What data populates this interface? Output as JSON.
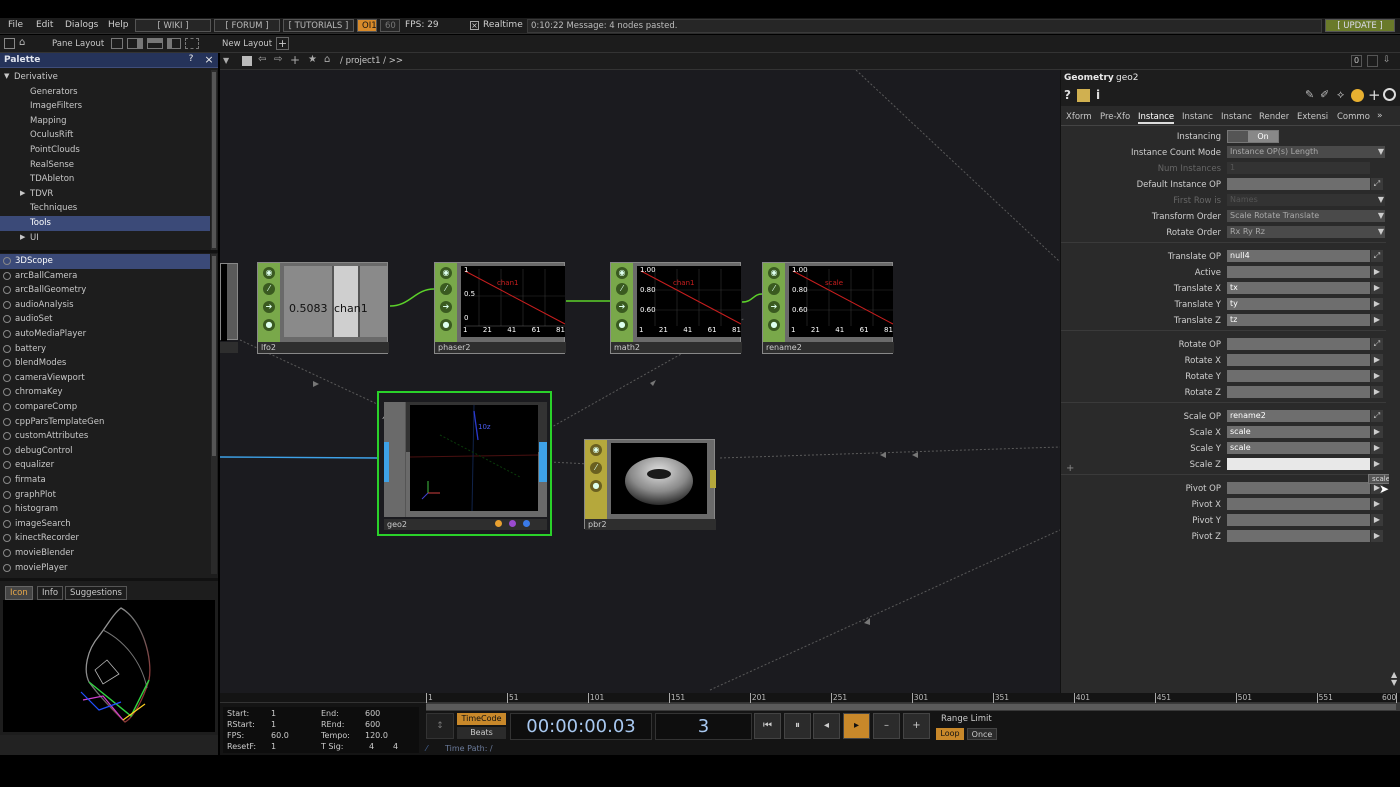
{
  "menu": {
    "items": [
      "File",
      "Edit",
      "Dialogs",
      "Help"
    ],
    "wiki": "[ WIKI ]",
    "forum": "[ FORUM ]",
    "tutorials": "[ TUTORIALS ]",
    "oi": "OI1",
    "sixty": "60",
    "fps": "FPS:  29",
    "realtime": "Realtime",
    "message": "0:10:22 Message: 4 nodes pasted.",
    "update": "[ UPDATE ]"
  },
  "toolbar": {
    "pane_layout": "Pane Layout",
    "new_layout": "New Layout",
    "path": "/ project1 / >>",
    "zero": "0"
  },
  "palette": {
    "title": "Palette",
    "help": "?",
    "close": "×",
    "tree": [
      "Derivative",
      "Generators",
      "ImageFilters",
      "Mapping",
      "OculusRift",
      "PointClouds",
      "RealSense",
      "TDAbleton",
      "TDVR",
      "Techniques",
      "Tools",
      "UI"
    ],
    "list": [
      "3DScope",
      "arcBallCamera",
      "arcBallGeometry",
      "audioAnalysis",
      "audioSet",
      "autoMediaPlayer",
      "battery",
      "blendModes",
      "cameraViewport",
      "chromaKey",
      "compareComp",
      "cppParsTemplateGen",
      "customAttributes",
      "debugControl",
      "equalizer",
      "firmata",
      "graphPlot",
      "histogram",
      "imageSearch",
      "kinectRecorder",
      "movieBlender",
      "moviePlayer"
    ],
    "tabs": [
      "Icon",
      "Info",
      "Suggestions"
    ]
  },
  "nodes": {
    "lfo": {
      "name": "lfo2",
      "value": "0.5083",
      "channel": "chan1"
    },
    "phaser": {
      "name": "phaser2",
      "channel": "chan1",
      "y_top": "1",
      "y_mid": "0.5",
      "y_bot": "0",
      "ticks": [
        "1",
        "21",
        "41",
        "61",
        "81"
      ]
    },
    "math": {
      "name": "math2",
      "channel": "chan1",
      "y": [
        "1.00",
        "0.80",
        "0.60"
      ],
      "ticks": [
        "1",
        "21",
        "41",
        "61",
        "81"
      ]
    },
    "rename": {
      "name": "rename2",
      "channel": "scale",
      "y": [
        "1.00",
        "0.80",
        "0.60"
      ],
      "ticks": [
        "1",
        "21",
        "41",
        "61",
        "81"
      ]
    },
    "geo": {
      "name": "geo2",
      "axis": "10z"
    },
    "pbr": {
      "name": "pbr2"
    }
  },
  "params": {
    "type": "Geometry",
    "name": "geo2",
    "tabs": [
      "Xform",
      "Pre-Xfo",
      "Instance",
      "Instanc",
      "Instanc",
      "Render",
      "Extensi",
      "Commo"
    ],
    "rows": [
      {
        "label": "Instancing",
        "value": "On"
      },
      {
        "label": "Instance Count Mode",
        "value": "Instance OP(s) Length"
      },
      {
        "label": "Num Instances",
        "value": "1"
      },
      {
        "label": "Default Instance OP",
        "value": ""
      },
      {
        "label": "First Row is",
        "value": "Names"
      },
      {
        "label": "Transform Order",
        "value": "Scale Rotate Translate"
      },
      {
        "label": "Rotate Order",
        "value": "Rx Ry Rz"
      },
      {
        "label": "Translate OP",
        "value": "null4"
      },
      {
        "label": "Active",
        "value": ""
      },
      {
        "label": "Translate X",
        "value": "tx"
      },
      {
        "label": "Translate Y",
        "value": "ty"
      },
      {
        "label": "Translate Z",
        "value": "tz"
      },
      {
        "label": "Rotate OP",
        "value": ""
      },
      {
        "label": "Rotate X",
        "value": ""
      },
      {
        "label": "Rotate Y",
        "value": ""
      },
      {
        "label": "Rotate Z",
        "value": ""
      },
      {
        "label": "Scale OP",
        "value": "rename2"
      },
      {
        "label": "Scale X",
        "value": "scale"
      },
      {
        "label": "Scale Y",
        "value": "scale"
      },
      {
        "label": "Scale Z",
        "value": ""
      },
      {
        "label": "Pivot OP",
        "value": ""
      },
      {
        "label": "Pivot X",
        "value": ""
      },
      {
        "label": "Pivot Y",
        "value": ""
      },
      {
        "label": "Pivot Z",
        "value": ""
      }
    ],
    "tooltip": "scale"
  },
  "timeline": {
    "ruler": [
      "1",
      "51",
      "101",
      "151",
      "201",
      "251",
      "301",
      "351",
      "401",
      "451",
      "501",
      "551",
      "600"
    ],
    "info": {
      "start_l": "Start:",
      "start_v": "1",
      "end_l": "End:",
      "end_v": "600",
      "rstart_l": "RStart:",
      "rstart_v": "1",
      "rend_l": "REnd:",
      "rend_v": "600",
      "fps_l": "FPS:",
      "fps_v": "60.0",
      "tempo_l": "Tempo:",
      "tempo_v": "120.0",
      "resetf_l": "ResetF:",
      "resetf_v": "1",
      "tsig_l": "T Sig:",
      "tsig_v1": "4",
      "tsig_v2": "4"
    },
    "timecode_label": "TimeCode",
    "beats_label": "Beats",
    "timecode": "00:00:00.03",
    "frame": "3",
    "range_limit": "Range Limit",
    "loop": "Loop",
    "once": "Once",
    "time_path": "Time Path: /"
  },
  "colors": {
    "accent": "#e8a84a",
    "chop": "#79a84a",
    "comp": "#b5a83c",
    "selected": "#2ad12a"
  }
}
